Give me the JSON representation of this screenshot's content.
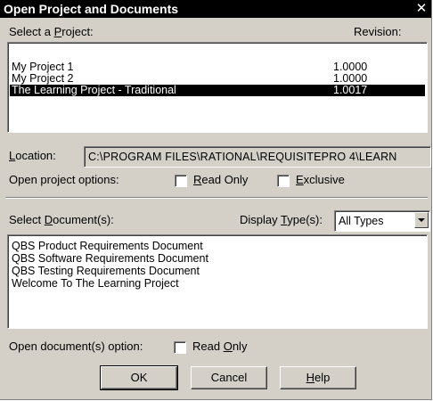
{
  "dialog": {
    "title": "Open Project and Documents",
    "close_glyph": "✕"
  },
  "project": {
    "label_pre": "Select a ",
    "label_key": "P",
    "label_post": "roject:",
    "revision_header": "Revision:",
    "rows": [
      {
        "name": "My Project 1",
        "revision": "1.0000",
        "selected": false
      },
      {
        "name": "My Project 2",
        "revision": "1.0000",
        "selected": false
      },
      {
        "name": "The Learning Project - Traditional",
        "revision": "1.0017",
        "selected": true
      }
    ]
  },
  "location": {
    "label_key": "L",
    "label_post": "ocation:",
    "value": "C:\\PROGRAM FILES\\RATIONAL\\REQUISITEPRO 4\\LEARN"
  },
  "project_options": {
    "label": "Open project options:",
    "read_only": {
      "pre": "",
      "key": "R",
      "post": "ead Only",
      "checked": false
    },
    "exclusive": {
      "pre": "",
      "key": "E",
      "post": "xclusive",
      "checked": false
    }
  },
  "documents": {
    "label_pre": "Select ",
    "label_key": "D",
    "label_post": "ocument(s):",
    "display_type_label_pre": "Display ",
    "display_type_label_key": "T",
    "display_type_label_post": "ype(s):",
    "display_type_value": "All Types",
    "items": [
      "QBS Product Requirements Document",
      "QBS Software Requirements Document",
      "QBS Testing Requirements Document",
      "Welcome To The Learning Project"
    ]
  },
  "document_options": {
    "label": "Open document(s) option:",
    "read_only": {
      "pre": "Read ",
      "key": "O",
      "post": "nly",
      "checked": false
    }
  },
  "buttons": {
    "ok": "OK",
    "cancel": "Cancel",
    "help_key": "H",
    "help_post": "elp"
  }
}
